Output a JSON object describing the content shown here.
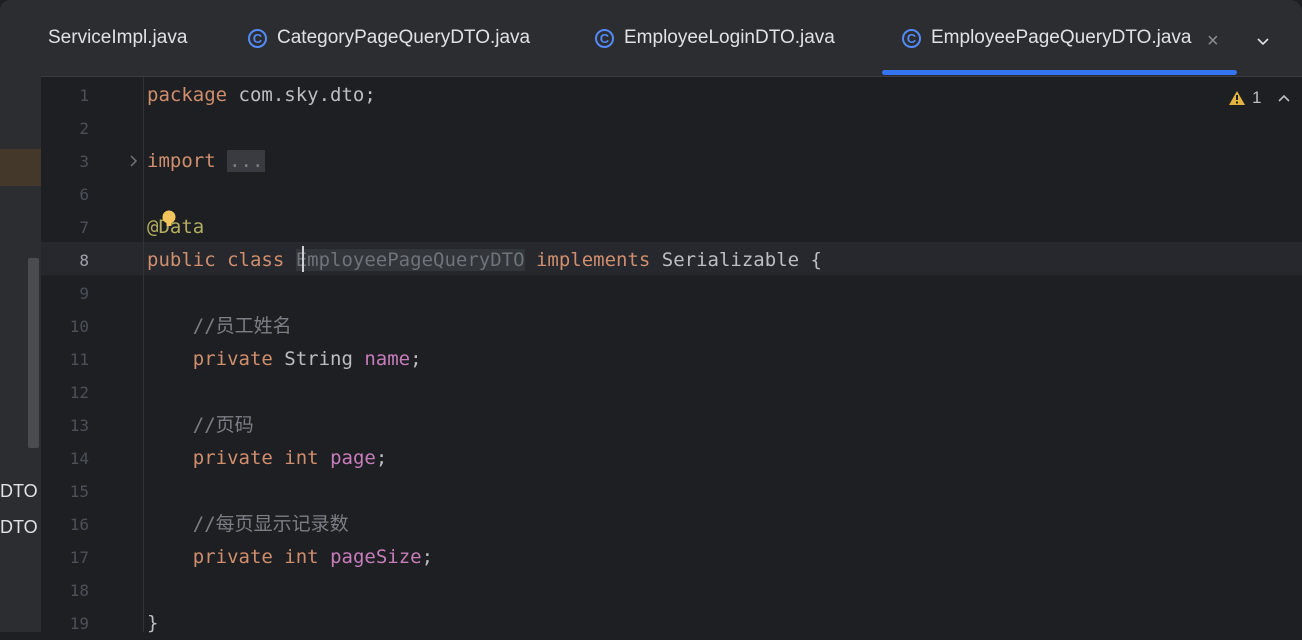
{
  "tool_window_fragments": [
    "DTO",
    "DTO"
  ],
  "tabs": [
    {
      "label": "ServiceImpl.java",
      "active": false,
      "icon": "class-icon"
    },
    {
      "label": "CategoryPageQueryDTO.java",
      "active": false,
      "icon": "class-icon"
    },
    {
      "label": "EmployeeLoginDTO.java",
      "active": false,
      "icon": "class-icon"
    },
    {
      "label": "EmployeePageQueryDTO.java",
      "active": true,
      "icon": "class-icon"
    }
  ],
  "tab_icon_glyph": "C",
  "close_glyph": "×",
  "editor": {
    "current_line": "8",
    "warning_count": "1",
    "line_numbers": [
      "1",
      "2",
      "3",
      "6",
      "7",
      "8",
      "9",
      "10",
      "11",
      "12",
      "13",
      "14",
      "15",
      "16",
      "17",
      "18",
      "19"
    ],
    "code": {
      "l1_kw": "package",
      "l1_rest": " com.sky.dto;",
      "l3_kw": "import",
      "l3_dots": "...",
      "l7_ann": "@Data",
      "l8_kw": "public class",
      "l8_cls": "EmployeePageQueryDTO",
      "l8_kw2": "implements",
      "l8_rest": " Serializable {",
      "l10_cmt": "//员工姓名",
      "l11_kw": "private",
      "l11_type": " String ",
      "l11_fld": "name",
      "l11_end": ";",
      "l13_cmt": "//页码",
      "l14_kw": "private int",
      "l14_fld": "page",
      "l14_end": ";",
      "l16_cmt": "//每页显示记录数",
      "l17_kw": "private int",
      "l17_fld": "pageSize",
      "l17_end": ";",
      "l19": "}"
    }
  },
  "colors": {
    "keyword": "#cf8e6d",
    "field": "#c77dbb",
    "annotation": "#b3ae60",
    "comment": "#7a7e85",
    "accent": "#3574f0",
    "warning": "#e3b341"
  }
}
